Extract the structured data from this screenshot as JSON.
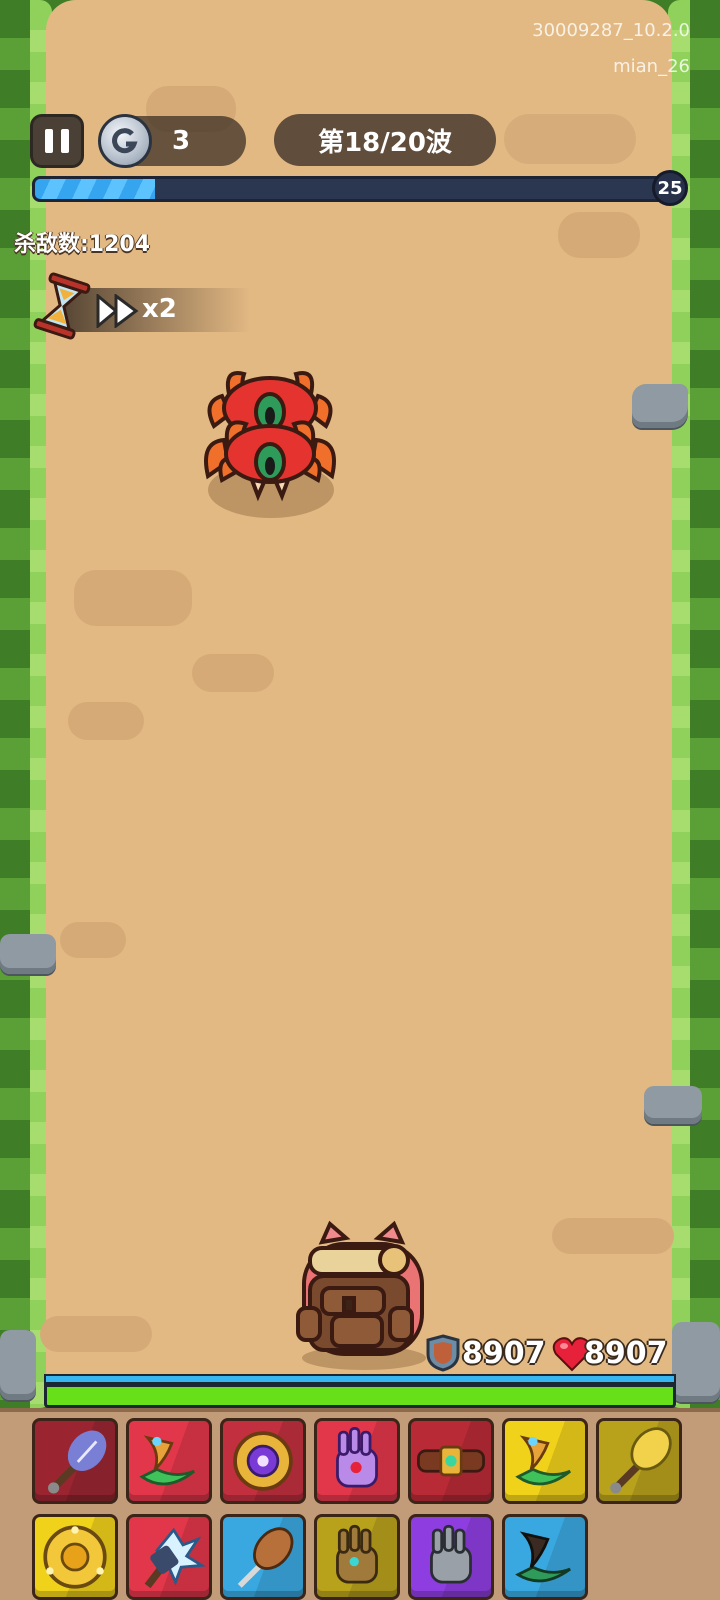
{
  "watermark": {
    "build": "30009287_10.2.0",
    "user": "mian_26"
  },
  "hud": {
    "coins": "3",
    "wave": "第18/20波",
    "xp_progress": 0.19,
    "level": "25",
    "kills": "杀敌数:1204",
    "speed": "x2"
  },
  "hero": {
    "shield": "8907",
    "hp": "8907",
    "hp_fraction": 1.0,
    "shield_fraction": 1.0
  },
  "enemies": [
    {
      "type": "red-crab-spider"
    },
    {
      "type": "red-crab-spider"
    }
  ],
  "inventory": {
    "slots": [
      {
        "icon": "feather-mace-icon",
        "rarity_color": "#9a2531"
      },
      {
        "icon": "green-dagger-icon",
        "rarity_color": "#e2364a"
      },
      {
        "icon": "spiked-ring-icon",
        "rarity_color": "#c23040"
      },
      {
        "icon": "purple-glove-icon",
        "rarity_color": "#e2364a"
      },
      {
        "icon": "jeweled-belt-icon",
        "rarity_color": "#b82a36"
      },
      {
        "icon": "green-dagger-icon",
        "rarity_color": "#f1d21a"
      },
      {
        "icon": "gold-feather-club-icon",
        "rarity_color": "#b8a21c"
      },
      {
        "icon": "gold-shield-icon",
        "rarity_color": "#f1d21a"
      },
      {
        "icon": "ice-spiked-hammer-icon",
        "rarity_color": "#e2364a"
      },
      {
        "icon": "brown-feather-club-icon",
        "rarity_color": "#3aa8e0"
      },
      {
        "icon": "leather-glove-icon",
        "rarity_color": "#b8a21c"
      },
      {
        "icon": "gray-glove-icon",
        "rarity_color": "#8e3ee0"
      },
      {
        "icon": "dark-dagger-icon",
        "rarity_color": "#3aa8e0"
      }
    ]
  }
}
